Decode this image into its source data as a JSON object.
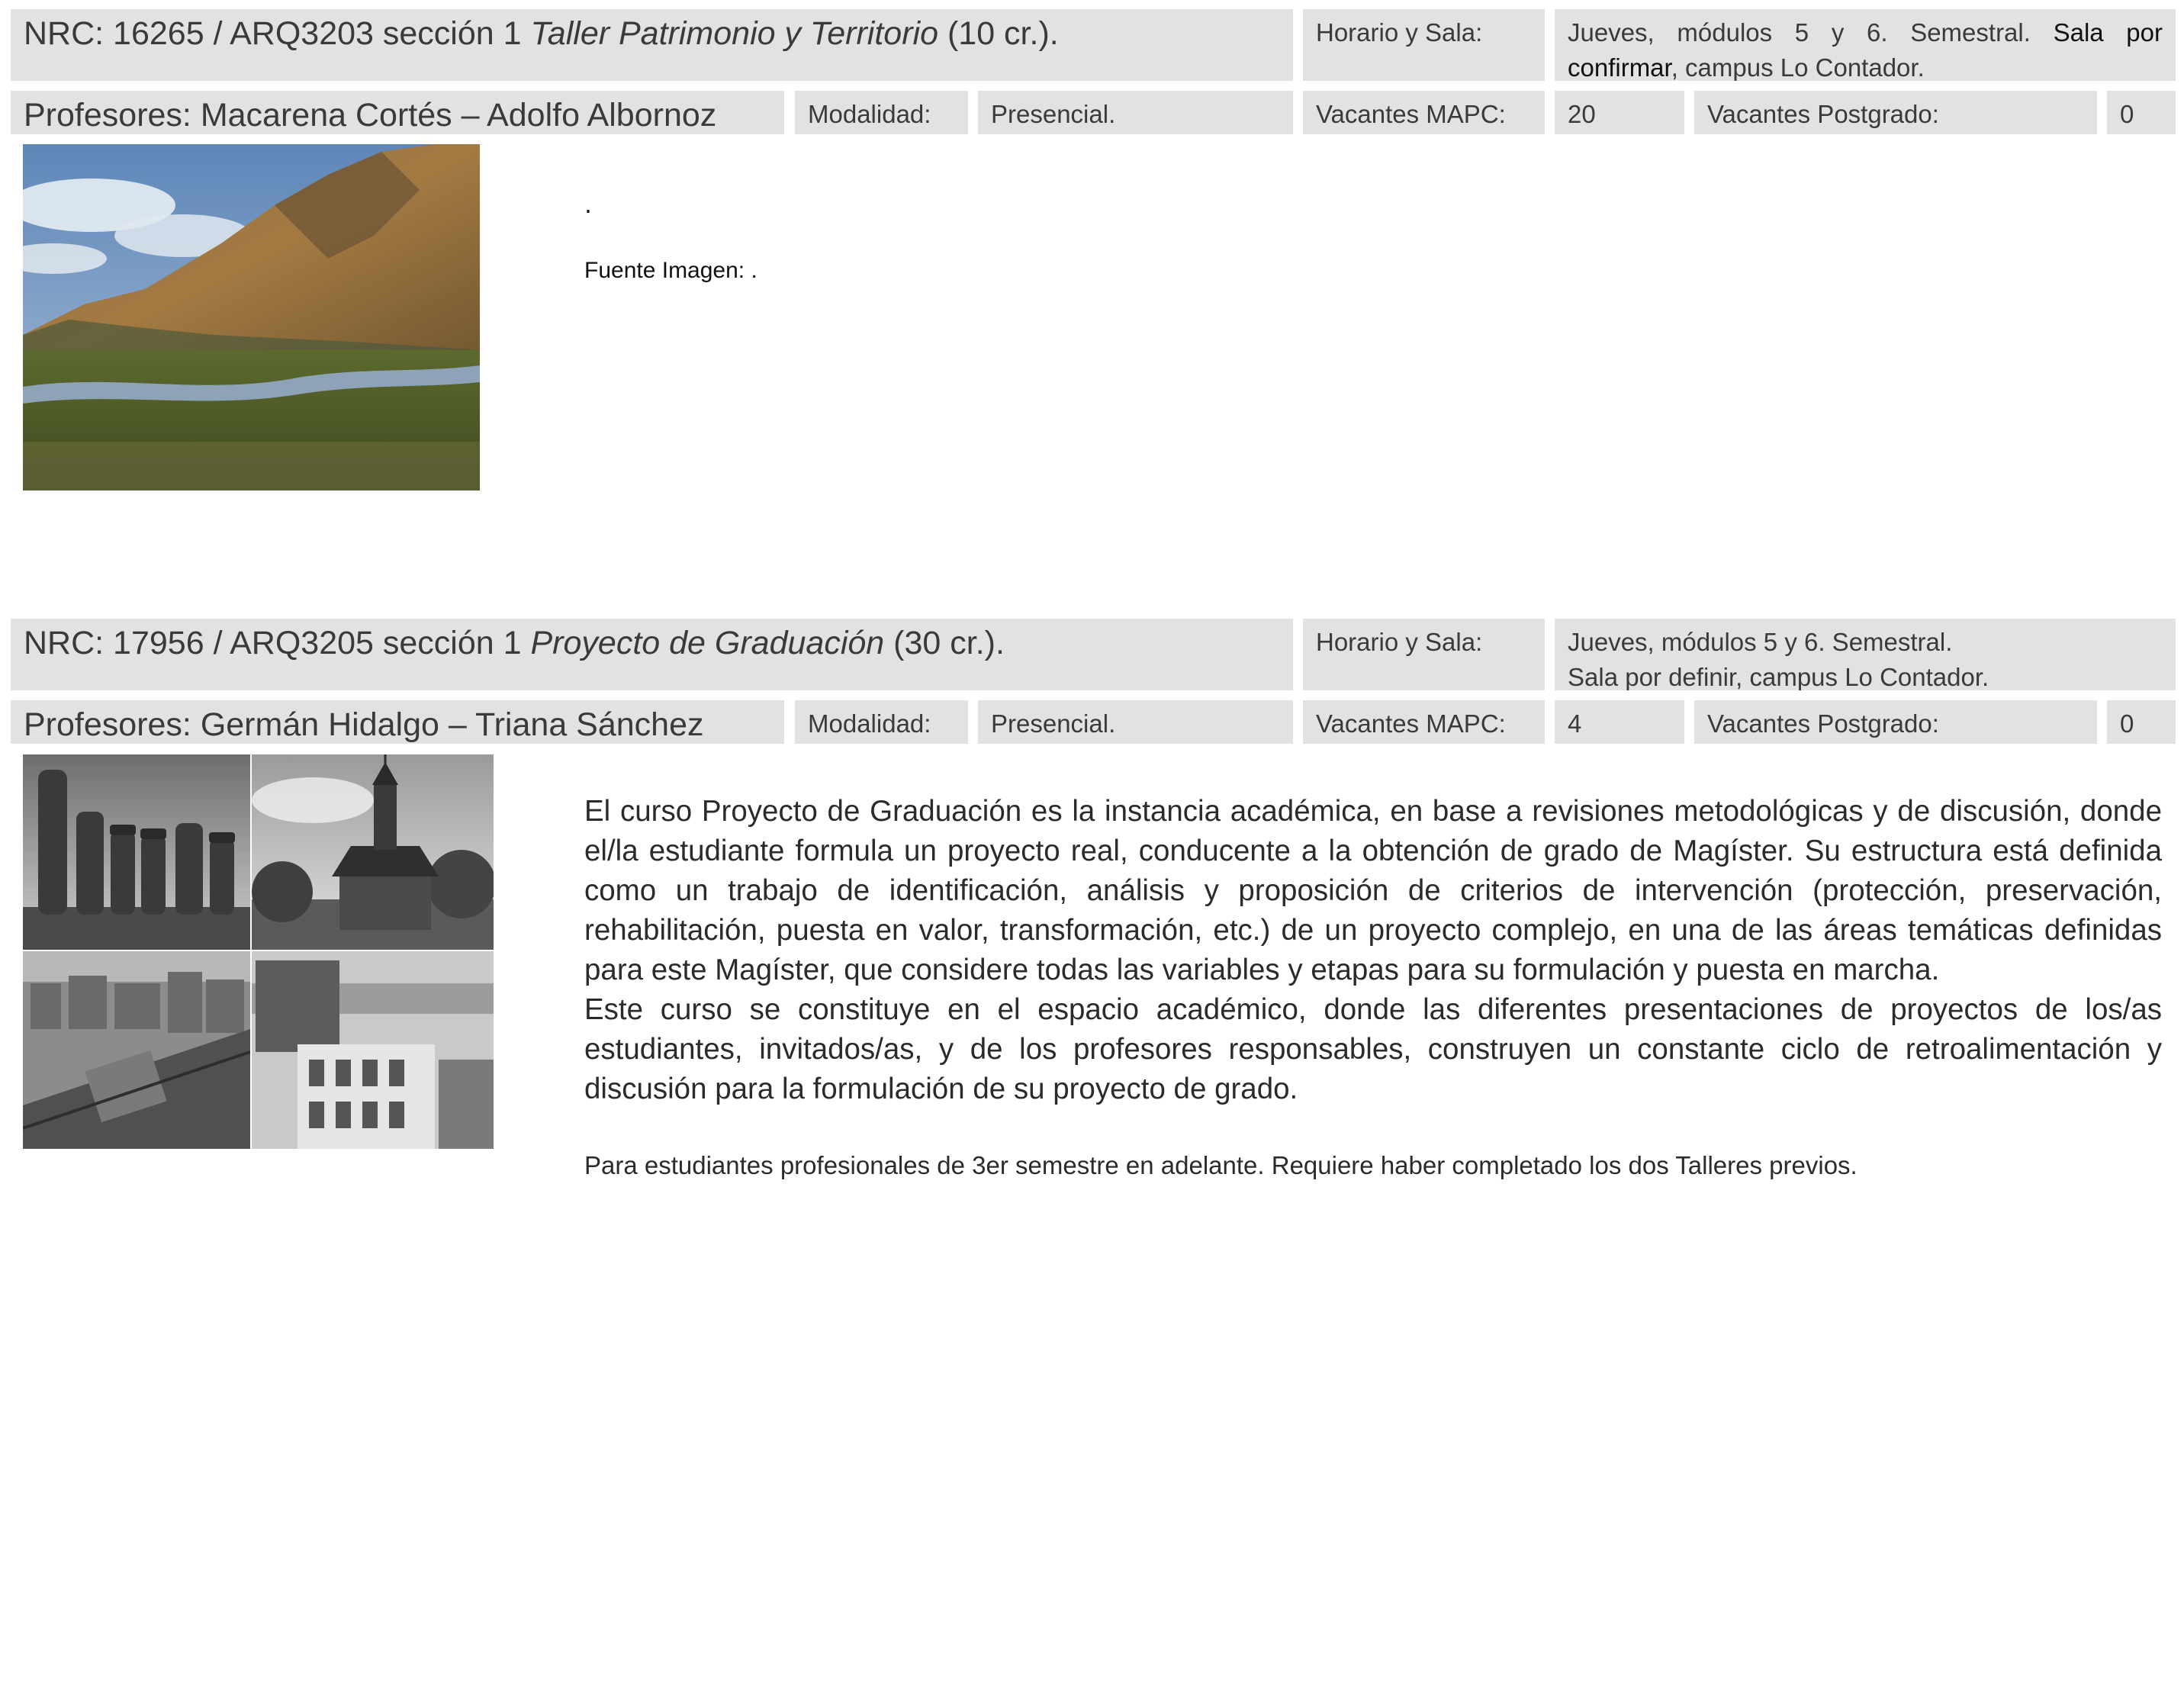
{
  "courses": [
    {
      "nrc_prefix": "NRC: 16265 / ARQ3203 sección 1 ",
      "title": "Taller Patrimonio y Territorio",
      "credits": " (10 cr.).",
      "schedule_label": "Horario y Sala:",
      "schedule_part1": "Jueves, módulos 5 y 6. Semestral. ",
      "schedule_highlight": "Sala por confirmar",
      "schedule_part2": ", campus Lo Contador.",
      "professors": "Profesores: Macarena Cortés – Adolfo Albornoz",
      "modality_label": "Modalidad:",
      "modality_value": "Presencial.",
      "vacancies_mapc_label": "Vacantes MAPC:",
      "vacancies_mapc_value": "20",
      "vacancies_postgrado_label": "Vacantes Postgrado:",
      "vacancies_postgrado_value": "0",
      "description": ".",
      "image_source": "Fuente Imagen: ."
    },
    {
      "nrc_prefix": "NRC: 17956 / ARQ3205 sección 1 ",
      "title": "Proyecto de Graduación",
      "credits": " (30 cr.).",
      "schedule_label": "Horario y Sala:",
      "schedule_line1": "Jueves, módulos 5 y 6. Semestral.",
      "schedule_line2": "Sala por definir, campus Lo Contador.",
      "professors": "Profesores: Germán Hidalgo – Triana Sánchez",
      "modality_label": "Modalidad:",
      "modality_value": "Presencial.",
      "vacancies_mapc_label": "Vacantes MAPC:",
      "vacancies_mapc_value": "4",
      "vacancies_postgrado_label": "Vacantes Postgrado:",
      "vacancies_postgrado_value": "0",
      "description_p1": "El curso Proyecto de Graduación es la instancia académica, en base a revisiones metodológicas y de discusión, donde el/la estudiante formula un proyecto real, conducente a la obtención de grado de Magíster. Su estructura está definida como un trabajo de identificación, análisis y proposición de criterios de intervención (protección, preservación, rehabilitación, puesta en valor, transformación, etc.) de un proyecto complejo, en una de las áreas temáticas definidas para este Magíster, que considere todas las variables y etapas para su formulación y puesta en marcha.",
      "description_p2": "Este curso se constituye en el espacio académico, donde las diferentes presentaciones de proyectos de los/as estudiantes, invitados/as, y de los profesores responsables, construyen un constante ciclo de retroalimentación y discusión para la formulación de su proyecto de grado.",
      "requirements": "Para estudiantes profesionales de 3er semestre en adelante. Requiere haber completado los dos Talleres previos."
    }
  ]
}
